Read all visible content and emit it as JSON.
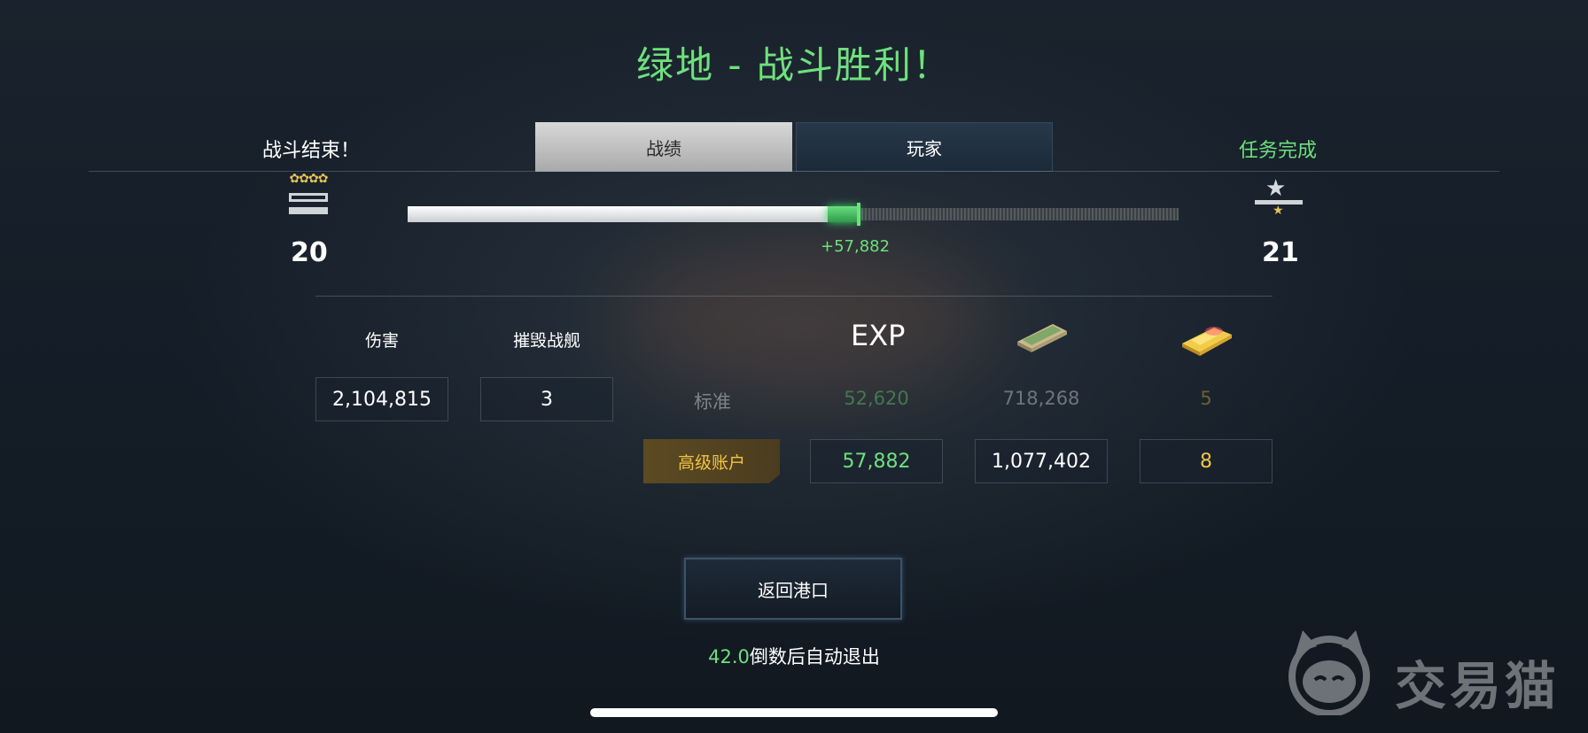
{
  "title": "绿地 - 战斗胜利！",
  "header": {
    "battle_end": "战斗结束！",
    "mission_complete": "任务完成",
    "tabs": [
      {
        "label": "战绩",
        "active": true
      },
      {
        "label": "玩家",
        "active": false
      }
    ]
  },
  "progress": {
    "current_level": "20",
    "next_level": "21",
    "xp_gain_label": "+57,882",
    "base_fraction": 0.545,
    "gain_fraction": 0.04
  },
  "stats": {
    "damage_label": "伤害",
    "damage_value": "2,104,815",
    "kills_label": "摧毁战舰",
    "kills_value": "3"
  },
  "rewards": {
    "exp_header": "EXP",
    "money_icon": "money-stack-icon",
    "gold_icon": "gold-bar-icon",
    "standard": {
      "label": "标准",
      "exp": "52,620",
      "credits": "718,268",
      "gold": "5"
    },
    "premium": {
      "label": "高级账户",
      "exp": "57,882",
      "credits": "1,077,402",
      "gold": "8"
    }
  },
  "actions": {
    "return_port": "返回港口",
    "countdown_number": "42.0",
    "countdown_text": "倒数后自动退出"
  },
  "watermark": {
    "text": "交易猫"
  },
  "colors": {
    "accent_green": "#6fe07e",
    "premium_gold": "#f2c444",
    "background": "#161f29"
  }
}
